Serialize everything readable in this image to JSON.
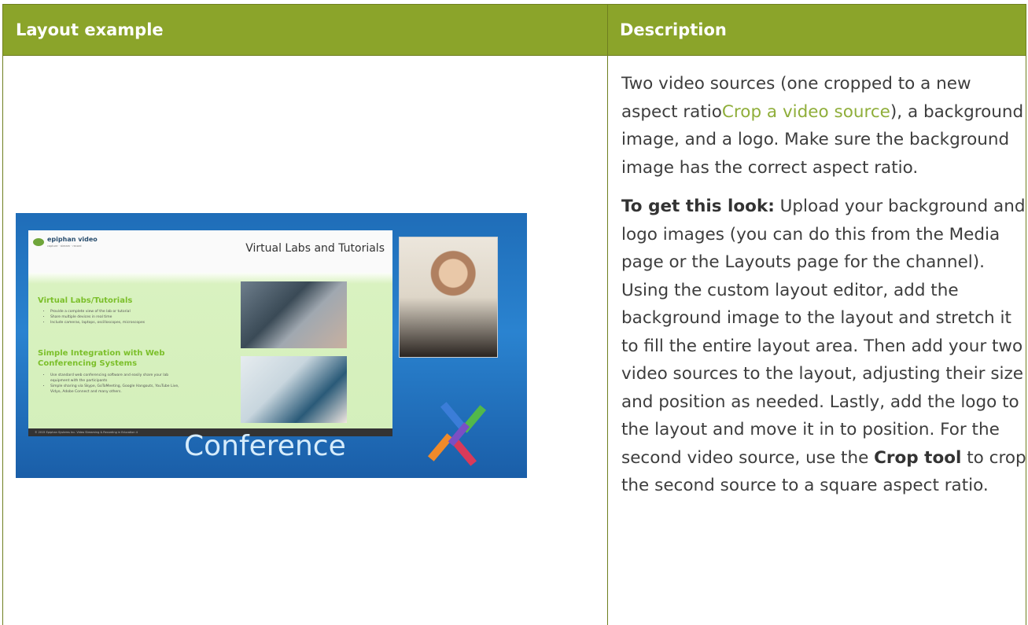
{
  "table": {
    "headers": {
      "layout_example": "Layout example",
      "description": "Description"
    }
  },
  "description": {
    "p1_before_link": "Two video sources (one cropped to a new aspect ratio",
    "p1_link": "Crop a video source",
    "p1_after_link": "), a background image, and a logo. Make sure the background image has the correct aspect ratio.",
    "p2_lead": "To get this look:",
    "p2_text_1": " Upload your background and logo images (you can do this from the Media page or the Layouts page for the channel). Using the custom layout editor, add the background image to the layout and stretch it to fill the entire layout area. Then add your two video sources to the layout, adjusting their size and position as needed. Lastly, add the logo to the layout and move it in to position. For the second video source, use the ",
    "p2_bold": "Crop tool",
    "p2_text_2": " to crop the second source to a square aspect ratio."
  },
  "example_image": {
    "slide": {
      "logo_text": "epiphan video",
      "logo_sub": "capture · stream · record",
      "title": "Virtual Labs and Tutorials",
      "heading1": "Virtual Labs/Tutorials",
      "bullets1": [
        "Provide a complete view of the lab or tutorial",
        "Share multiple devices in real time",
        "Include cameras, laptops, oscilloscopes, microscopes"
      ],
      "heading2": "Simple Integration with Web Conferencing Systems",
      "bullets2": [
        "Use standard web conferencing software and easily share your lab equipment with the participants",
        "Simple sharing via Skype, GoToMeeting, Google Hangouts, YouTube Live, Vidyo, Adobe Connect and many others."
      ],
      "footer": "© 2015 Epiphan Systems Inc.          Video Streaming & Recording in Education          4"
    },
    "caption": "Conference",
    "colors": {
      "background": "#1f6db8",
      "heading": "#7bbf2a",
      "header_bar": "#8ba42a",
      "link": "#8fae3a"
    }
  }
}
